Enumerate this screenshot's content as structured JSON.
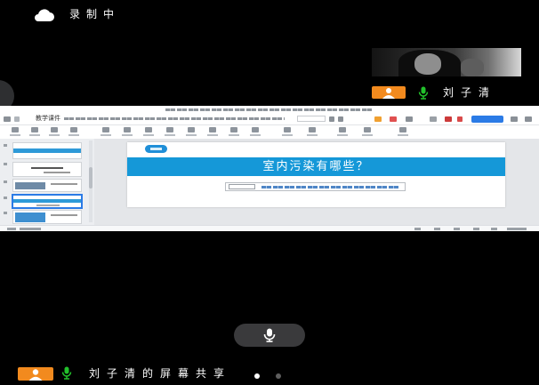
{
  "top_bar": {
    "recording_icon": "cloud-icon",
    "recording_label": "录制中"
  },
  "participant_tile": {
    "name": "刘子清",
    "avatar_icon": "user-avatar-icon",
    "mic_icon": "microphone-on-icon",
    "avatar_color": "#f28a1e",
    "mic_color": "#22c12b"
  },
  "shared_screen": {
    "tab_title": "教学课件",
    "accent_color": "#2b7be6",
    "slide": {
      "heading": "室内污染有哪些？",
      "banner_color": "#1598d8"
    }
  },
  "controls": {
    "mic_button_icon": "microphone-icon"
  },
  "footer": {
    "sharer_label": "刘子清的屏幕共享",
    "avatar_icon": "user-avatar-icon",
    "mic_icon": "microphone-on-icon",
    "page_indicator": {
      "current": 1,
      "total": 2
    }
  }
}
